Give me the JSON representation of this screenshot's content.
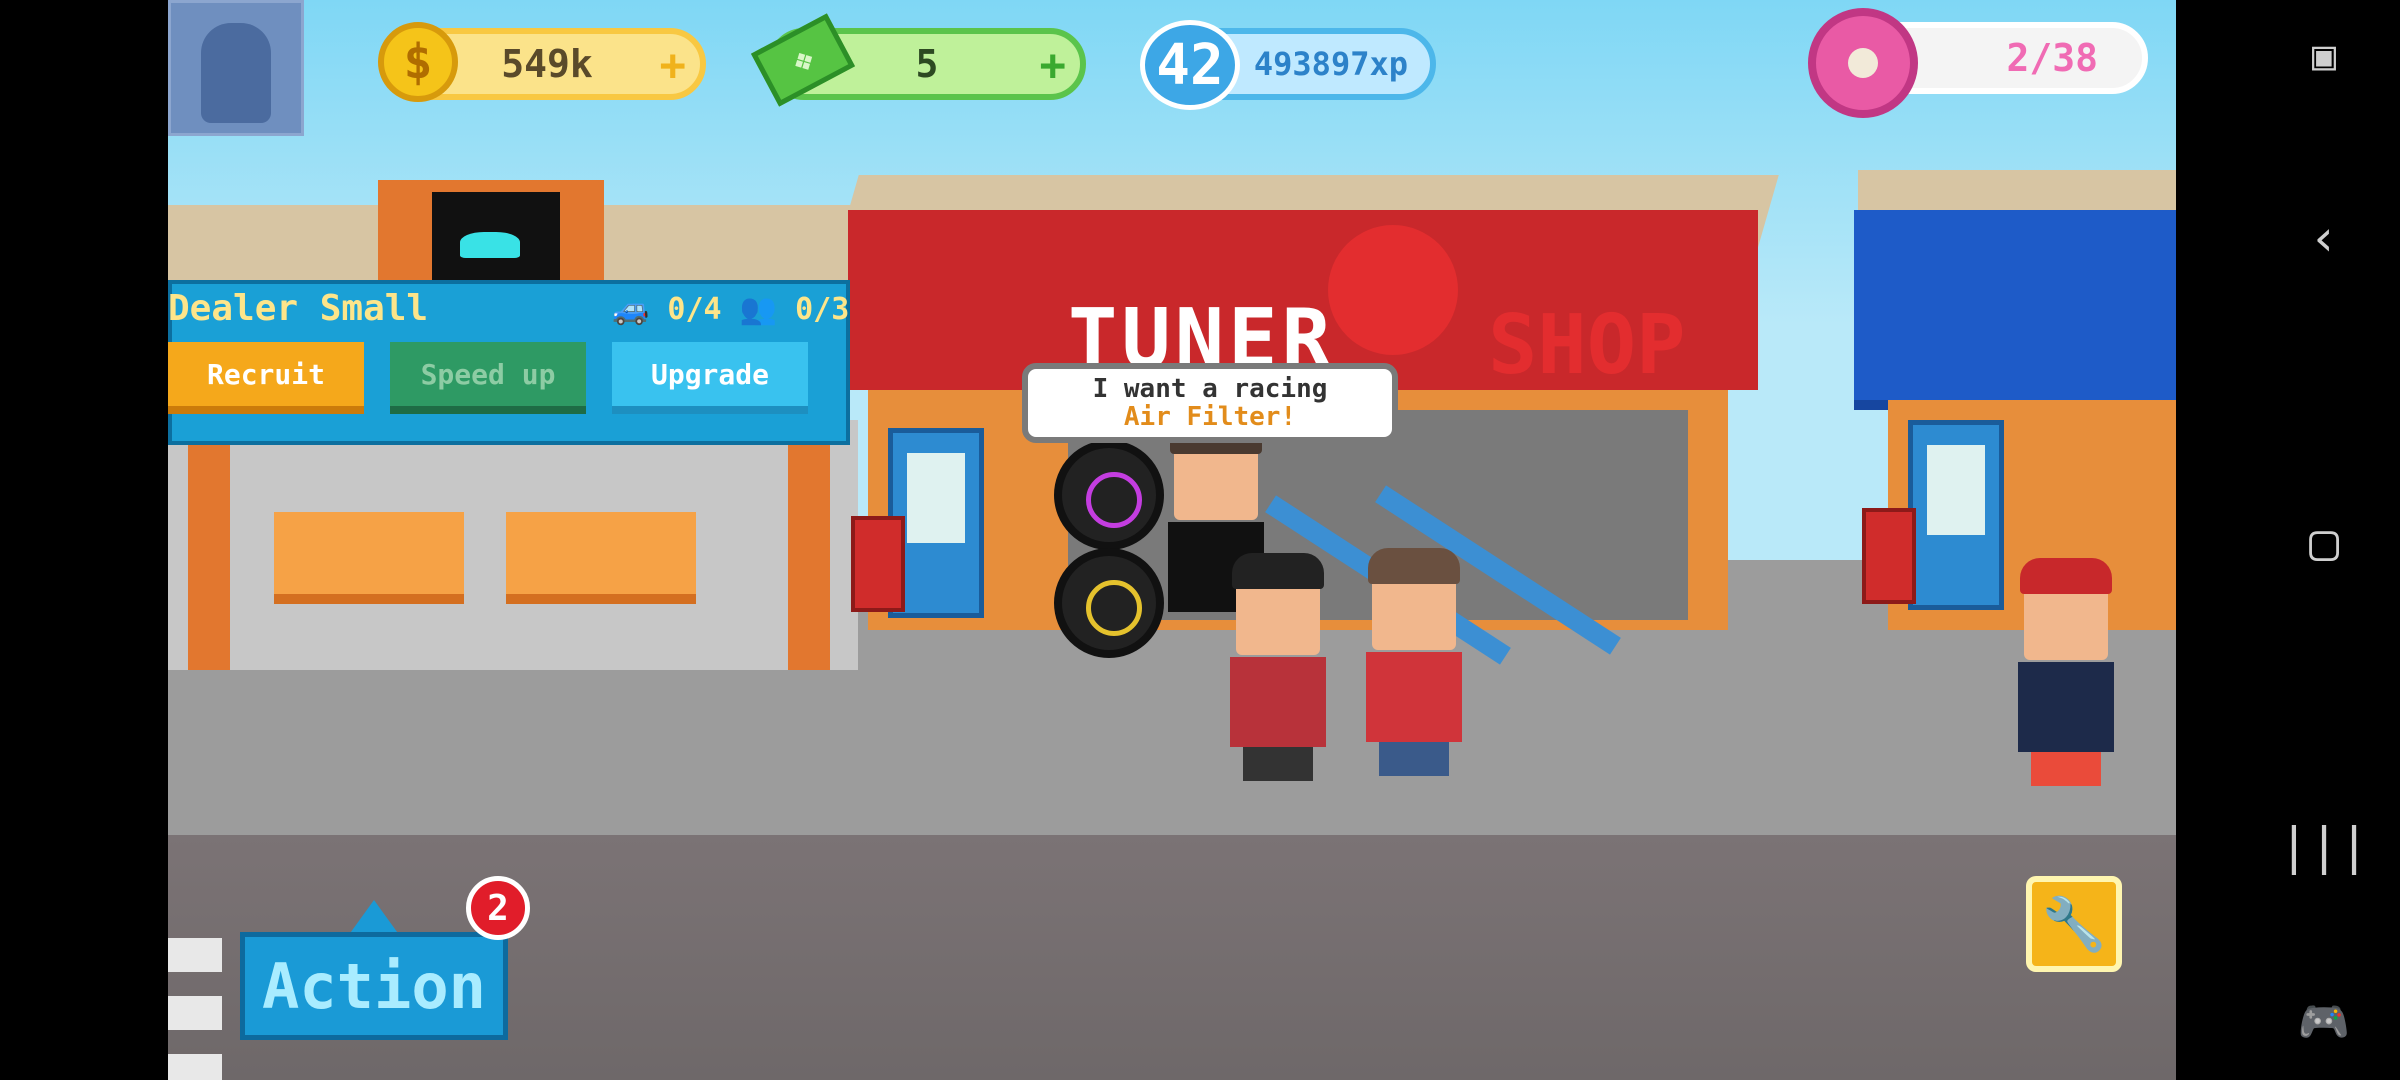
{
  "hud": {
    "coins": "549k",
    "cash": "5",
    "plus": "+",
    "coin_symbol": "$",
    "level": "42",
    "xp": "493897xp",
    "donuts": "2/38"
  },
  "dealer_panel": {
    "title": "Dealer Small",
    "cars": "0/4",
    "staff": "0/3",
    "buttons": {
      "recruit": "Recruit",
      "speed_up": "Speed up",
      "upgrade": "Upgrade"
    }
  },
  "shop_sign": {
    "left": "TUNER",
    "right": "SHOP"
  },
  "speech_bubble": {
    "line1": "I want a racing",
    "line2": "Air Filter!"
  },
  "action": {
    "label": "Action",
    "badge": "2"
  },
  "icons": {
    "wrench": "🔧",
    "car": "🚙",
    "people": "👥"
  },
  "system_nav": {
    "back": "‹",
    "home": "▢",
    "recents": "|||"
  },
  "colors": {
    "sky": "#7fd7f5",
    "road": "#6e6869",
    "yellow_line": "#f2d411",
    "tuner_red": "#c9282b",
    "panel_blue": "#1aa0d6"
  }
}
